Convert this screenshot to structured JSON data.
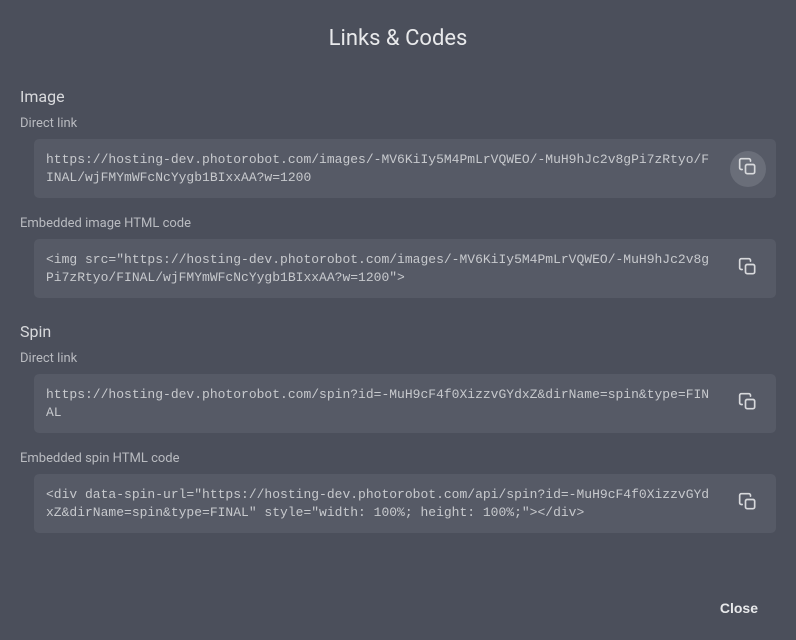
{
  "title": "Links & Codes",
  "sections": {
    "image": {
      "header": "Image",
      "direct": {
        "label": "Direct link",
        "value": "https://hosting-dev.photorobot.com/images/-MV6KiIy5M4PmLrVQWEO/-MuH9hJc2v8gPi7zRtyo/FINAL/wjFMYmWFcNcYygb1BIxxAA?w=1200"
      },
      "embed": {
        "label": "Embedded image HTML code",
        "value": "<img src=\"https://hosting-dev.photorobot.com/images/-MV6KiIy5M4PmLrVQWEO/-MuH9hJc2v8gPi7zRtyo/FINAL/wjFMYmWFcNcYygb1BIxxAA?w=1200\">"
      }
    },
    "spin": {
      "header": "Spin",
      "direct": {
        "label": "Direct link",
        "value": "https://hosting-dev.photorobot.com/spin?id=-MuH9cF4f0XizzvGYdxZ&dirName=spin&type=FINAL"
      },
      "embed": {
        "label": "Embedded spin HTML code",
        "value": "<div data-spin-url=\"https://hosting-dev.photorobot.com/api/spin?id=-MuH9cF4f0XizzvGYdxZ&dirName=spin&type=FINAL\" style=\"width: 100%; height: 100%;\"></div>"
      }
    }
  },
  "footer": {
    "close": "Close"
  }
}
